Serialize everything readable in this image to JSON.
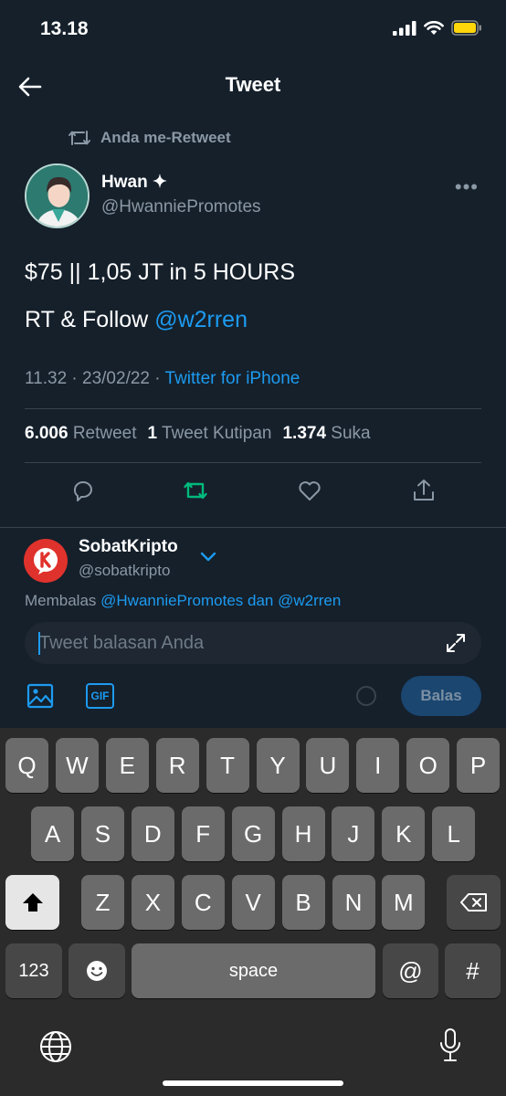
{
  "status_bar": {
    "time": "13.18"
  },
  "header": {
    "title": "Tweet"
  },
  "tweet": {
    "retweet_context": "Anda me-Retweet",
    "author_name": "Hwan ✦",
    "author_handle": "@HwanniePromotes",
    "text_line1": "$75 || 1,05 JT in 5 HOURS",
    "text_line2_prefix": "RT & Follow ",
    "text_line2_mention": "@w2rren",
    "meta_time": "11.32 · 23/02/22 · ",
    "meta_source": "Twitter for iPhone",
    "stats": {
      "retweet_count": "6.006",
      "retweet_label": "Retweet",
      "quote_count": "1",
      "quote_label": "Tweet Kutipan",
      "like_count": "1.374",
      "like_label": "Suka"
    }
  },
  "reply": {
    "user_name": "SobatKripto",
    "user_handle": "@sobatkripto",
    "replying_prefix": "Membalas ",
    "replying_targets": "@HwanniePromotes dan @w2rren",
    "placeholder": "Tweet balasan Anda",
    "gif_label": "GIF",
    "send_label": "Balas"
  },
  "keyboard": {
    "row1": [
      "Q",
      "W",
      "E",
      "R",
      "T",
      "Y",
      "U",
      "I",
      "O",
      "P"
    ],
    "row2": [
      "A",
      "S",
      "D",
      "F",
      "G",
      "H",
      "J",
      "K",
      "L"
    ],
    "row3": [
      "Z",
      "X",
      "C",
      "V",
      "B",
      "N",
      "M"
    ],
    "numbers_label": "123",
    "space_label": "space",
    "at_label": "@",
    "hash_label": "#"
  },
  "colors": {
    "background": "#15202b",
    "accent": "#1d9bf0",
    "retweet_active": "#00ba7c",
    "muted": "#8b98a5"
  }
}
